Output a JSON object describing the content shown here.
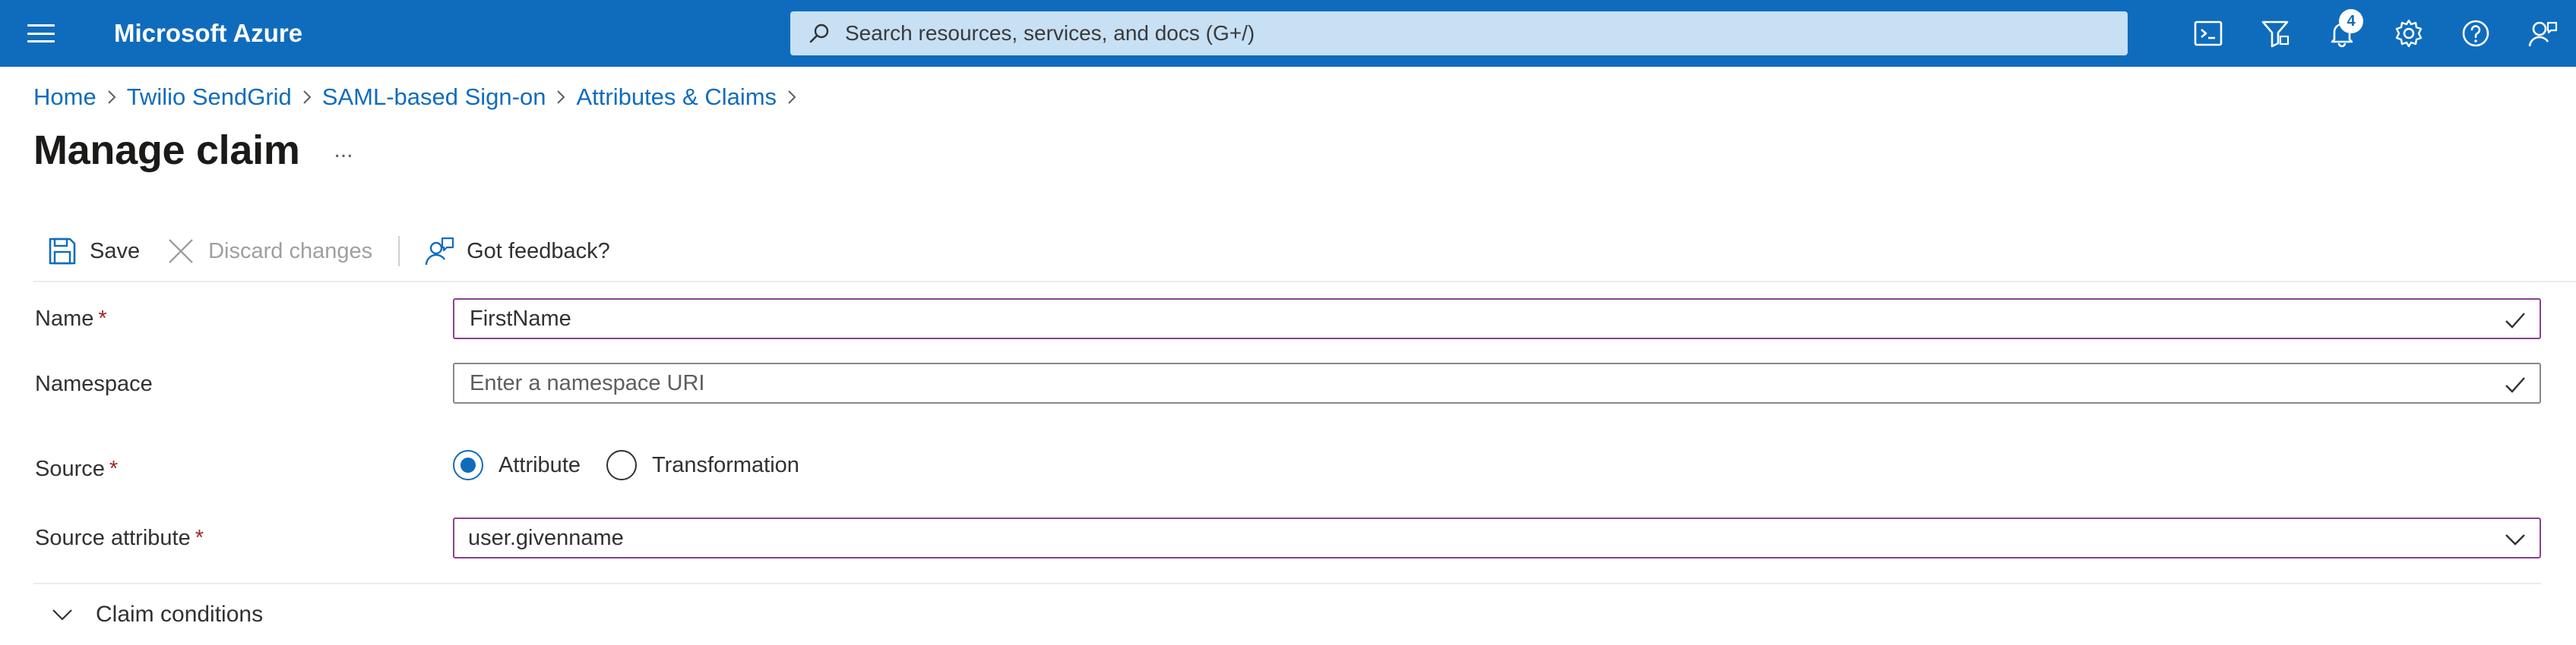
{
  "topbar": {
    "brand": "Microsoft Azure",
    "search_placeholder": "Search resources, services, and docs (G+/)",
    "notification_count": "4",
    "bar_color": "#0f6cbd",
    "icons": [
      "cloud-shell-icon",
      "directory-filter-icon",
      "bell-icon",
      "gear-icon",
      "help-icon",
      "feedback-person-icon"
    ]
  },
  "breadcrumb": {
    "items": [
      "Home",
      "Twilio SendGrid",
      "SAML-based Sign-on",
      "Attributes & Claims"
    ]
  },
  "page": {
    "title": "Manage claim",
    "more": "..."
  },
  "toolbar": {
    "save_label": "Save",
    "discard_label": "Discard changes",
    "feedback_label": "Got feedback?"
  },
  "form": {
    "name_label": "Name",
    "name_value": "FirstName",
    "namespace_label": "Namespace",
    "namespace_value": "",
    "namespace_placeholder": "Enter a namespace URI",
    "source_label": "Source",
    "source_options": [
      "Attribute",
      "Transformation"
    ],
    "source_selected": "Attribute",
    "source_attribute_label": "Source attribute",
    "source_attribute_value": "user.givenname",
    "required_marker": "*",
    "accent_color": "#0f6cbd",
    "focus_border_color": "#8a3f93",
    "required_color": "#a4262c"
  },
  "claim_conditions": {
    "label": "Claim conditions"
  }
}
